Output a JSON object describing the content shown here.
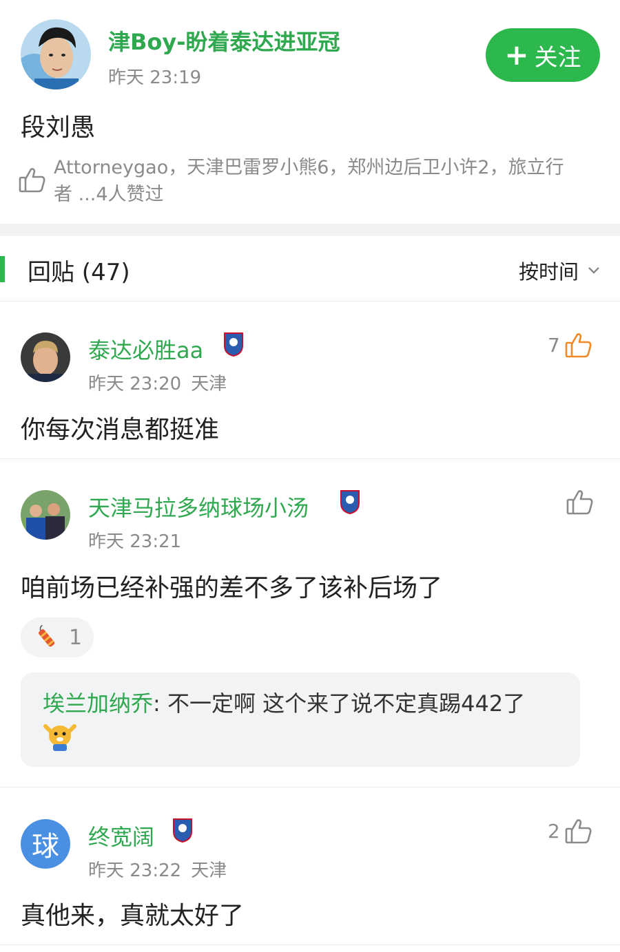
{
  "post": {
    "author": "津Boy-盼着泰达进亚冠",
    "time": "昨天 23:19",
    "follow_label": "关注",
    "content": "段刘愚",
    "likers_text": "Attorneygao，天津巴雷罗小熊6，郑州边后卫小许2，旅立行者 ...4人赞过"
  },
  "replies": {
    "title": "回贴 (47)",
    "sort_label": "按时间"
  },
  "comments": [
    {
      "user": "泰达必胜aa",
      "time": "昨天 23:20",
      "location": "天津",
      "likes": "7",
      "content": "你每次消息都挺准"
    },
    {
      "user": "天津马拉多纳球场小汤",
      "time": "昨天 23:21",
      "location": "",
      "likes": "",
      "content": "咱前场已经补强的差不多了该补后场了",
      "reaction_count": "1",
      "sub_reply": {
        "user": "埃兰加纳乔",
        "text": ": 不一定啊 这个来了说不定真踢442了"
      }
    },
    {
      "user": "终宽阔",
      "time": "昨天 23:22",
      "location": "天津",
      "likes": "2",
      "content": "真他来，真就太好了",
      "avatar_letter": "球"
    }
  ],
  "colors": {
    "accent_green": "#2db84d",
    "username_green": "#2fa84f",
    "liked_orange": "#f08a24",
    "letter_avatar_blue": "#4a90e2"
  },
  "icons": [
    "thumbs-up-icon",
    "plus-icon",
    "chevron-down-icon",
    "team-badge-icon",
    "firecracker-icon",
    "emoji-sticker-icon"
  ]
}
